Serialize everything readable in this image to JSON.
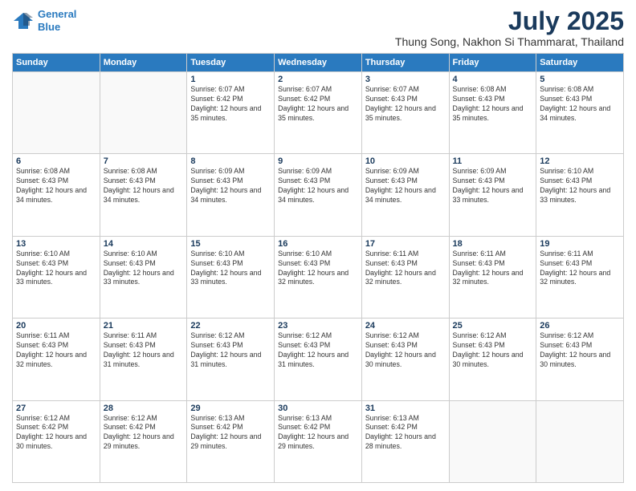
{
  "header": {
    "logo_line1": "General",
    "logo_line2": "Blue",
    "main_title": "July 2025",
    "subtitle": "Thung Song, Nakhon Si Thammarat, Thailand"
  },
  "days_of_week": [
    "Sunday",
    "Monday",
    "Tuesday",
    "Wednesday",
    "Thursday",
    "Friday",
    "Saturday"
  ],
  "weeks": [
    [
      {
        "day": "",
        "info": ""
      },
      {
        "day": "",
        "info": ""
      },
      {
        "day": "1",
        "info": "Sunrise: 6:07 AM\nSunset: 6:42 PM\nDaylight: 12 hours and 35 minutes."
      },
      {
        "day": "2",
        "info": "Sunrise: 6:07 AM\nSunset: 6:42 PM\nDaylight: 12 hours and 35 minutes."
      },
      {
        "day": "3",
        "info": "Sunrise: 6:07 AM\nSunset: 6:43 PM\nDaylight: 12 hours and 35 minutes."
      },
      {
        "day": "4",
        "info": "Sunrise: 6:08 AM\nSunset: 6:43 PM\nDaylight: 12 hours and 35 minutes."
      },
      {
        "day": "5",
        "info": "Sunrise: 6:08 AM\nSunset: 6:43 PM\nDaylight: 12 hours and 34 minutes."
      }
    ],
    [
      {
        "day": "6",
        "info": "Sunrise: 6:08 AM\nSunset: 6:43 PM\nDaylight: 12 hours and 34 minutes."
      },
      {
        "day": "7",
        "info": "Sunrise: 6:08 AM\nSunset: 6:43 PM\nDaylight: 12 hours and 34 minutes."
      },
      {
        "day": "8",
        "info": "Sunrise: 6:09 AM\nSunset: 6:43 PM\nDaylight: 12 hours and 34 minutes."
      },
      {
        "day": "9",
        "info": "Sunrise: 6:09 AM\nSunset: 6:43 PM\nDaylight: 12 hours and 34 minutes."
      },
      {
        "day": "10",
        "info": "Sunrise: 6:09 AM\nSunset: 6:43 PM\nDaylight: 12 hours and 34 minutes."
      },
      {
        "day": "11",
        "info": "Sunrise: 6:09 AM\nSunset: 6:43 PM\nDaylight: 12 hours and 33 minutes."
      },
      {
        "day": "12",
        "info": "Sunrise: 6:10 AM\nSunset: 6:43 PM\nDaylight: 12 hours and 33 minutes."
      }
    ],
    [
      {
        "day": "13",
        "info": "Sunrise: 6:10 AM\nSunset: 6:43 PM\nDaylight: 12 hours and 33 minutes."
      },
      {
        "day": "14",
        "info": "Sunrise: 6:10 AM\nSunset: 6:43 PM\nDaylight: 12 hours and 33 minutes."
      },
      {
        "day": "15",
        "info": "Sunrise: 6:10 AM\nSunset: 6:43 PM\nDaylight: 12 hours and 33 minutes."
      },
      {
        "day": "16",
        "info": "Sunrise: 6:10 AM\nSunset: 6:43 PM\nDaylight: 12 hours and 32 minutes."
      },
      {
        "day": "17",
        "info": "Sunrise: 6:11 AM\nSunset: 6:43 PM\nDaylight: 12 hours and 32 minutes."
      },
      {
        "day": "18",
        "info": "Sunrise: 6:11 AM\nSunset: 6:43 PM\nDaylight: 12 hours and 32 minutes."
      },
      {
        "day": "19",
        "info": "Sunrise: 6:11 AM\nSunset: 6:43 PM\nDaylight: 12 hours and 32 minutes."
      }
    ],
    [
      {
        "day": "20",
        "info": "Sunrise: 6:11 AM\nSunset: 6:43 PM\nDaylight: 12 hours and 32 minutes."
      },
      {
        "day": "21",
        "info": "Sunrise: 6:11 AM\nSunset: 6:43 PM\nDaylight: 12 hours and 31 minutes."
      },
      {
        "day": "22",
        "info": "Sunrise: 6:12 AM\nSunset: 6:43 PM\nDaylight: 12 hours and 31 minutes."
      },
      {
        "day": "23",
        "info": "Sunrise: 6:12 AM\nSunset: 6:43 PM\nDaylight: 12 hours and 31 minutes."
      },
      {
        "day": "24",
        "info": "Sunrise: 6:12 AM\nSunset: 6:43 PM\nDaylight: 12 hours and 30 minutes."
      },
      {
        "day": "25",
        "info": "Sunrise: 6:12 AM\nSunset: 6:43 PM\nDaylight: 12 hours and 30 minutes."
      },
      {
        "day": "26",
        "info": "Sunrise: 6:12 AM\nSunset: 6:43 PM\nDaylight: 12 hours and 30 minutes."
      }
    ],
    [
      {
        "day": "27",
        "info": "Sunrise: 6:12 AM\nSunset: 6:42 PM\nDaylight: 12 hours and 30 minutes."
      },
      {
        "day": "28",
        "info": "Sunrise: 6:12 AM\nSunset: 6:42 PM\nDaylight: 12 hours and 29 minutes."
      },
      {
        "day": "29",
        "info": "Sunrise: 6:13 AM\nSunset: 6:42 PM\nDaylight: 12 hours and 29 minutes."
      },
      {
        "day": "30",
        "info": "Sunrise: 6:13 AM\nSunset: 6:42 PM\nDaylight: 12 hours and 29 minutes."
      },
      {
        "day": "31",
        "info": "Sunrise: 6:13 AM\nSunset: 6:42 PM\nDaylight: 12 hours and 28 minutes."
      },
      {
        "day": "",
        "info": ""
      },
      {
        "day": "",
        "info": ""
      }
    ]
  ]
}
